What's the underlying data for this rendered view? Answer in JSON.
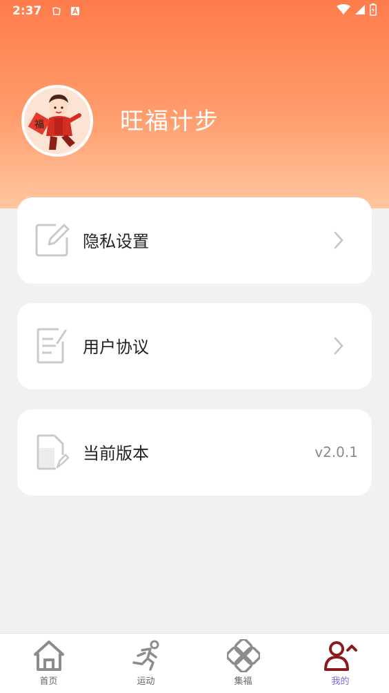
{
  "status_bar": {
    "time": "2:37",
    "icons": [
      "notification-icon",
      "a-badge-icon",
      "wifi-icon",
      "signal-icon",
      "battery-icon"
    ]
  },
  "profile": {
    "app_name": "旺福计步",
    "avatar_glyph": "福",
    "avatar_icon": "mascot-avatar"
  },
  "menu": {
    "privacy": {
      "label": "隐私设置",
      "icon": "edit-icon"
    },
    "agreement": {
      "label": "用户协议",
      "icon": "document-edit-icon"
    },
    "version": {
      "label": "当前版本",
      "icon": "file-icon",
      "value": "v2.0.1"
    }
  },
  "tabbar": {
    "items": [
      {
        "label": "首页",
        "icon": "home-icon"
      },
      {
        "label": "运动",
        "icon": "running-icon"
      },
      {
        "label": "集福",
        "icon": "clover-icon"
      },
      {
        "label": "我的",
        "icon": "user-icon",
        "active": true
      }
    ]
  },
  "colors": {
    "header_top": "#ff7b4b",
    "header_bottom": "#ffc7a0",
    "active_tab": "#7b68d8",
    "active_icon": "#8b1a1a",
    "background": "#f1f1f1"
  }
}
